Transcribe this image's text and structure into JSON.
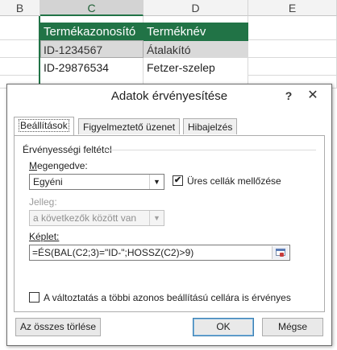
{
  "sheet": {
    "columns": [
      "B",
      "C",
      "D",
      "E"
    ],
    "header_row": [
      "Termékazonosító",
      "Terméknév"
    ],
    "rows": [
      [
        "ID-1234567",
        "Átalakító"
      ],
      [
        "ID-29876534",
        "Fetzer-szelep"
      ]
    ],
    "colors": {
      "header_green": "#217346"
    }
  },
  "dialog": {
    "title": "Adatok érvényesítése",
    "help_label": "?",
    "close_label": "✕",
    "tabs": [
      {
        "label": "Beállítások",
        "active": true
      },
      {
        "label": "Figyelmeztető üzenet",
        "active": false
      },
      {
        "label": "Hibajelzés",
        "active": false
      }
    ],
    "group_label": "Érvényességi feltétel",
    "allow": {
      "label": "Megengedve:",
      "value": "Egyéni"
    },
    "ignore_blank": {
      "label": "Üres cellák mellőzése",
      "checked": true
    },
    "data": {
      "label": "Jelleg:",
      "value": "a következők között van"
    },
    "formula": {
      "label": "Képlet:",
      "value": "=ÉS(BAL(C2;3)=\"ID-\";HOSSZ(C2)>9)"
    },
    "apply_all": {
      "label": "A változtatás a többi azonos beállítású cellára is érvényes",
      "checked": false
    },
    "buttons": {
      "clear_all": "Az összes törlése",
      "ok": "OK",
      "cancel": "Mégse"
    }
  }
}
